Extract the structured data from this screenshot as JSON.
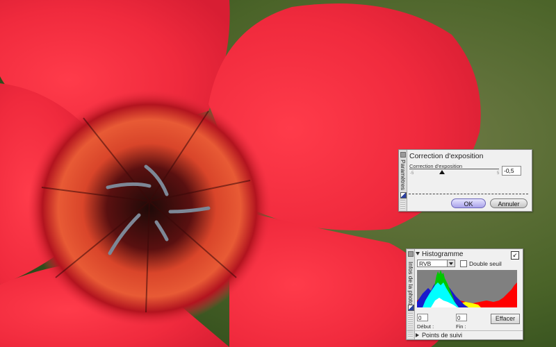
{
  "exposure_dialog": {
    "side_tab_label": "Paramètres",
    "title": "Correction d'exposition",
    "slider_label": "Correction d'exposition",
    "slider_min_mark": "-5",
    "slider_max_mark": "5",
    "value": "-0,5",
    "ok_label": "OK",
    "cancel_label": "Annuler"
  },
  "histogram_panel": {
    "side_tab_label": "Infos de la photo",
    "title": "Histogramme",
    "pin_symbol": "↙",
    "channel_selected": "RVB",
    "double_threshold_label": "Double seuil",
    "start_value": "0",
    "end_value": "0",
    "start_label": "Début :",
    "end_label": "Fin :",
    "clear_label": "Effacer",
    "tracking_points_label": "Points de suivi"
  },
  "colors": {
    "ok_button": "#a9a3ea",
    "histogram_bg": "#808080",
    "histogram_red": "#ff0000",
    "histogram_green": "#00c800",
    "histogram_blue": "#1a1acc",
    "histogram_cyan": "#00ffff",
    "histogram_yellow": "#ffff00",
    "histogram_white": "#ffffff"
  }
}
